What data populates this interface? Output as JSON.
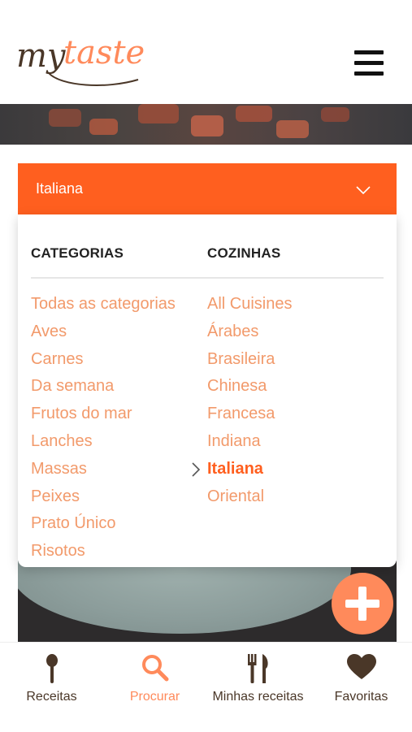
{
  "brand": {
    "logo_my": "my",
    "logo_taste": "taste",
    "dark_color": "#4a3728",
    "accent_color": "#ff8a5b"
  },
  "filter": {
    "selected_value": "Italiana",
    "bar_color": "#ff5f1f",
    "categories_header": "CATEGORIAS",
    "cuisines_header": "COZINHAS",
    "categories": [
      "Todas as categorias",
      "Aves",
      "Carnes",
      "Da semana",
      "Frutos do mar",
      "Lanches",
      "Massas",
      "Peixes",
      "Prato Único",
      "Risotos"
    ],
    "cuisines": [
      "All Cuisines",
      "Árabes",
      "Brasileira",
      "Chinesa",
      "Francesa",
      "Indiana",
      "Italiana",
      "Oriental"
    ],
    "selected_cuisine": "Italiana"
  },
  "icons": {
    "menu": "hamburger-menu-icon",
    "select": "chevron-down-icon",
    "selected_item": "chevron-right-icon",
    "add": "plus-icon"
  },
  "nav": {
    "items": [
      {
        "label": "Receitas",
        "icon": "spoon-icon",
        "active": false
      },
      {
        "label": "Procurar",
        "icon": "search-icon",
        "active": true
      },
      {
        "label": "Minhas receitas",
        "icon": "fork-knife-icon",
        "active": false
      },
      {
        "label": "Favoritas",
        "icon": "heart-icon",
        "active": false
      }
    ]
  }
}
